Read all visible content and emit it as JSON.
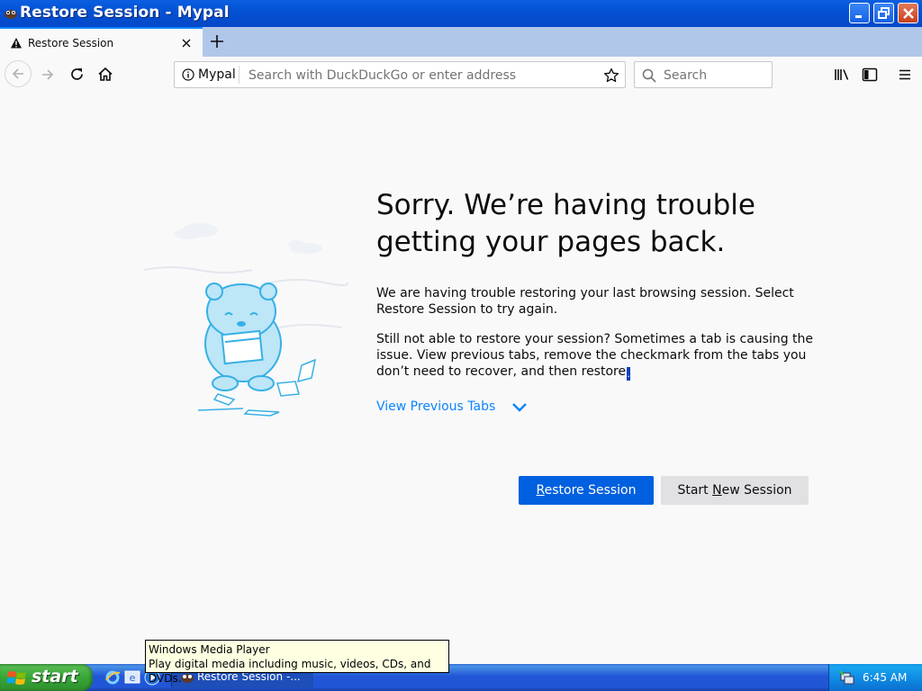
{
  "window": {
    "title": "Restore Session - Mypal"
  },
  "tabs": [
    {
      "label": "Restore Session",
      "icon": "warning-icon"
    }
  ],
  "navbar": {
    "site_label": "Mypal",
    "url_placeholder": "Search with DuckDuckGo or enter address",
    "search_placeholder": "Search"
  },
  "content": {
    "heading": "Sorry. We’re having trouble getting your pages back.",
    "paragraph1": "We are having trouble restoring your last browsing session. Select Restore Session to try again.",
    "paragraph2": "Still not able to restore your session? Sometimes a tab is causing the issue. View previous tabs, remove the checkmark from the tabs you don’t need to recover, and then restore",
    "paragraph2_end": ".",
    "view_previous_tabs": "View Previous Tabs",
    "restore_button": {
      "underlined": "R",
      "rest": "estore Session"
    },
    "new_session_button": {
      "before": "Start ",
      "underlined": "N",
      "after": "ew Session"
    }
  },
  "tooltip": {
    "title": "Windows Media Player",
    "description": "Play digital media including music, videos, CDs, and DVDs."
  },
  "taskbar": {
    "start_label": "start",
    "task_label": "Restore Session -...",
    "clock": "6:45 AM"
  },
  "colors": {
    "accent": "#0060df",
    "link": "#0a84ff",
    "titlebar": "#0452d4",
    "taskbar": "#2157d7",
    "start_green": "#37a637"
  }
}
